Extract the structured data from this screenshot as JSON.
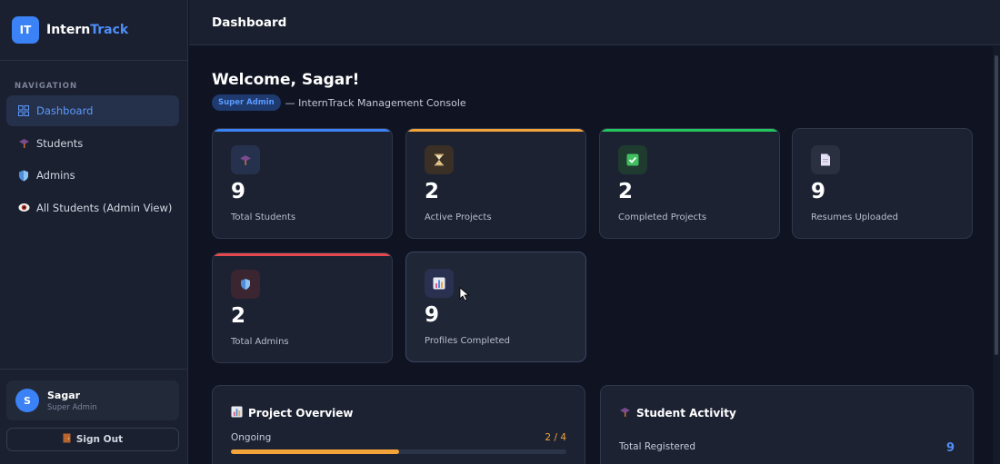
{
  "brand": {
    "logo": "IT",
    "name_main": "Intern",
    "name_accent": "Track"
  },
  "sidebar": {
    "heading": "NAVIGATION",
    "items": [
      {
        "label": "Dashboard",
        "icon": "grid-icon",
        "active": true
      },
      {
        "label": "Students",
        "icon": "graduation-cap-icon",
        "active": false
      },
      {
        "label": "Admins",
        "icon": "shield-icon",
        "active": false
      },
      {
        "label": "All Students (Admin View)",
        "icon": "eye-icon",
        "active": false
      }
    ],
    "user": {
      "initial": "S",
      "name": "Sagar",
      "role": "Super Admin"
    },
    "signout_label": "Sign Out"
  },
  "topbar": {
    "title": "Dashboard"
  },
  "welcome": {
    "title": "Welcome, Sagar!",
    "badge": "Super Admin",
    "subtitle": "— InternTrack Management Console"
  },
  "stats": [
    {
      "value": "9",
      "label": "Total Students",
      "icon": "graduation-cap-icon",
      "accent": "#3b82f6"
    },
    {
      "value": "2",
      "label": "Active Projects",
      "icon": "hourglass-icon",
      "accent": "#f2a33a"
    },
    {
      "value": "2",
      "label": "Completed Projects",
      "icon": "checkmark-icon",
      "accent": "#22c55e"
    },
    {
      "value": "9",
      "label": "Resumes Uploaded",
      "icon": "document-icon",
      "accent": ""
    },
    {
      "value": "2",
      "label": "Total Admins",
      "icon": "shield-icon",
      "accent": "#e5484d"
    },
    {
      "value": "9",
      "label": "Profiles Completed",
      "icon": "bar-chart-icon",
      "accent": ""
    }
  ],
  "project_overview": {
    "title": "Project Overview",
    "row_label": "Ongoing",
    "row_value": "2 / 4",
    "progress": 0.5
  },
  "student_activity": {
    "title": "Student Activity",
    "row_label": "Total Registered",
    "row_value": "9"
  }
}
